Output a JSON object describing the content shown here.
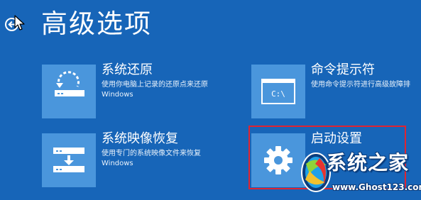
{
  "page": {
    "title": "高级选项",
    "background_color": "#1765b8",
    "tile_color": "#4a96dc",
    "highlight_color": "#df2431"
  },
  "back_button": {
    "icon": "back-arrow-icon"
  },
  "options": [
    {
      "id": "system-restore",
      "title": "系统还原",
      "description": [
        "使用你电脑上记录的还原点来还原",
        "Windows"
      ],
      "icon": "restore-icon"
    },
    {
      "id": "command-prompt",
      "title": "命令提示符",
      "description": [
        "使用命令提示符进行高级故障排"
      ],
      "icon": "command-prompt-icon",
      "icon_text": "C:\\"
    },
    {
      "id": "system-image-recovery",
      "title": "系统映像恢复",
      "description": [
        "使用专门的系统映像文件来恢复",
        "Windows"
      ],
      "icon": "image-recovery-icon"
    },
    {
      "id": "startup-settings",
      "title": "启动设置",
      "description": [],
      "icon": "gear-icon"
    }
  ],
  "watermark": {
    "title": "系统之家",
    "url": "www.Ghost123.com",
    "icon": "watermark-logo-icon"
  }
}
